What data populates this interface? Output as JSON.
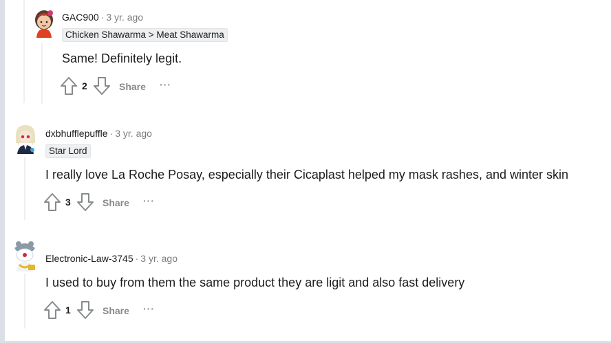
{
  "comments": [
    {
      "author": "GAC900",
      "separator": "·",
      "time": "3 yr. ago",
      "flair": "Chicken Shawarma > Meat Shawarma",
      "body": "Same! Definitely legit.",
      "score": "2",
      "share_label": "Share",
      "more_label": "···",
      "avatar_colors": {
        "skin": "#f3c8a8",
        "hair": "#b53d2c",
        "shirt": "#e04020"
      }
    },
    {
      "author": "dxbhufflepuffle",
      "separator": "·",
      "time": "3 yr. ago",
      "flair": "Star Lord",
      "body": "I really love La Roche Posay, especially their Cicaplast helped my mask rashes, and winter skin",
      "score": "3",
      "share_label": "Share",
      "more_label": "···",
      "avatar_colors": {
        "hair": "#e9e2c2",
        "eyes": "#d0283a",
        "outfit": "#1f2a44"
      }
    },
    {
      "author": "Electronic-Law-3745",
      "separator": "·",
      "time": "3 yr. ago",
      "flair": "",
      "body": "I used to buy from them the same product they are ligit and also fast delivery",
      "score": "1",
      "share_label": "Share",
      "more_label": "···",
      "avatar_colors": {
        "hat": "#8a9aa8",
        "accent": "#d0283a",
        "chain": "#e4b82a"
      }
    }
  ],
  "icons": {
    "upvote": "upvote-arrow-icon",
    "downvote": "downvote-arrow-icon"
  },
  "colors": {
    "background": "#dae0e6",
    "card": "#ffffff",
    "thread_line": "#edeff1",
    "meta_gray": "#7c7c7c",
    "action_gray": "#878a8c",
    "flair_bg": "#edeff1"
  }
}
